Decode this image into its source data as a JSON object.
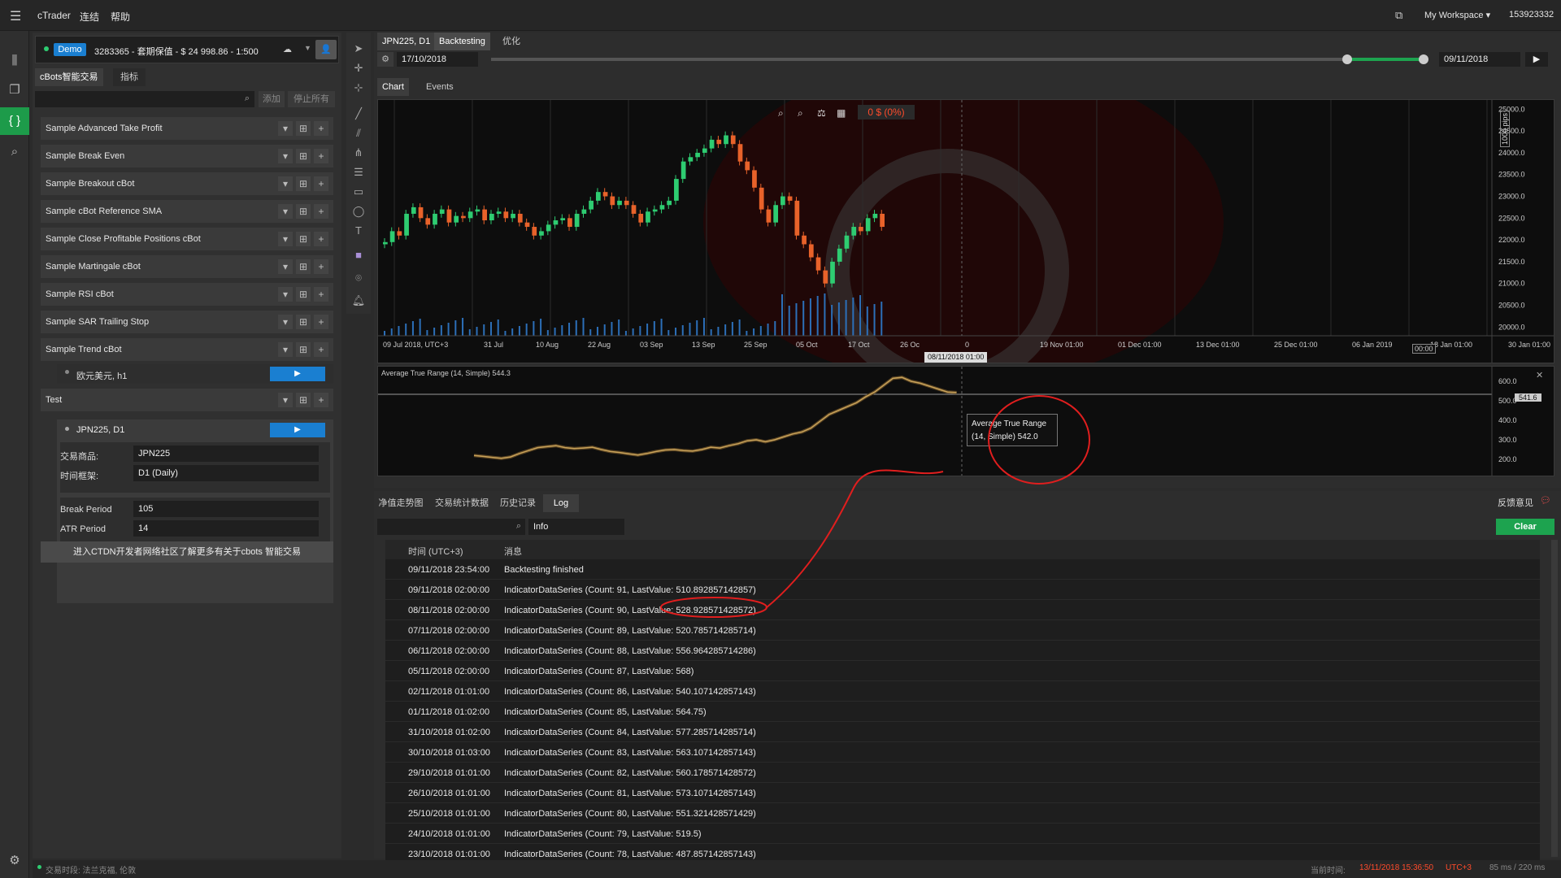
{
  "app": {
    "title": "cTrader",
    "menus": [
      "连结",
      "帮助"
    ],
    "workspace": "My Workspace ▾",
    "account_number": "153923332"
  },
  "account": {
    "badge": "Demo",
    "text": "3283365 - 套期保值 - $ 24 998.86 - 1:500"
  },
  "left_tabs": [
    "cBots智能交易",
    "指标"
  ],
  "search": {
    "placeholder": "",
    "add": "添加",
    "stop_all": "停止所有"
  },
  "bots": [
    "Sample Advanced Take Profit",
    "Sample Break Even",
    "Sample Breakout cBot",
    "Sample cBot Reference SMA",
    "Sample Close Profitable Positions cBot",
    "Sample Martingale cBot",
    "Sample RSI cBot",
    "Sample SAR Trailing Stop",
    "Sample Trend cBot"
  ],
  "trend_instance": "欧元美元, h1",
  "test_bot": {
    "name": "Test",
    "instance": "JPN225, D1",
    "params": [
      {
        "label": "交易商品:",
        "value": "JPN225"
      },
      {
        "label": "时间框架:",
        "value": "D1 (Daily)"
      },
      {
        "label": "Break Period",
        "value": "105"
      },
      {
        "label": "ATR Period",
        "value": "14"
      }
    ]
  },
  "community_link": "进入CTDN开发者网络社区了解更多有关于cbots 智能交易",
  "chart_tabs": [
    "JPN225, D1",
    "Backtesting",
    "优化"
  ],
  "backtest": {
    "from": "17/10/2018",
    "to": "09/11/2018"
  },
  "chart_subtabs": [
    "Chart",
    "Events"
  ],
  "chart_overlay": {
    "pnl": "0 $ (0%)",
    "pips_label": "1000 pips",
    "crosshair_date": "08/11/2018 01:00",
    "indicator_title": "Average True Range (14, Simple) 544.3",
    "indicator_value": "541.6",
    "tooltip_line1": "Average True Range",
    "tooltip_line2": "(14, Simple)  542.0",
    "time_marker": "00:00"
  },
  "chart_data": {
    "type": "candlestick",
    "y_ticks": [
      "25000.0",
      "24500.0",
      "24000.0",
      "23500.0",
      "23000.0",
      "22500.0",
      "22000.0",
      "21500.0",
      "21000.0",
      "20500.0",
      "20000.0"
    ],
    "x_ticks": [
      "09 Jul 2018, UTC+3",
      "31 Jul",
      "10 Aug",
      "22 Aug",
      "03 Sep",
      "13 Sep",
      "25 Sep",
      "05 Oct",
      "17 Oct",
      "26 Oc",
      "0",
      "19 Nov 01:00",
      "01 Dec 01:00",
      "13 Dec 01:00",
      "25 Dec 01:00",
      "06 Jan 2019",
      "18 Jan 01:00",
      "30 Jan 01:00"
    ],
    "close": [
      21950,
      22200,
      22100,
      22600,
      22750,
      22500,
      22350,
      22600,
      22700,
      22400,
      22550,
      22500,
      22650,
      22700,
      22450,
      22600,
      22650,
      22500,
      22600,
      22400,
      22300,
      22100,
      22200,
      22350,
      22450,
      22500,
      22300,
      22600,
      22700,
      22900,
      23100,
      23000,
      22800,
      22900,
      22800,
      22600,
      22400,
      22650,
      22700,
      22800,
      22900,
      23400,
      23800,
      23900,
      24000,
      24100,
      24300,
      24200,
      24400,
      24200,
      23800,
      23600,
      23200,
      22700,
      22400,
      22800,
      23000,
      22900,
      22100,
      21900,
      21600,
      21300,
      21000,
      21500,
      21800,
      22100,
      22300,
      22200,
      22500,
      22600,
      22300
    ],
    "atr_ticks": [
      "600.0",
      "500.0",
      "400.0",
      "300.0",
      "200.0"
    ],
    "atr": [
      220,
      215,
      210,
      205,
      212,
      230,
      245,
      260,
      265,
      270,
      260,
      255,
      258,
      262,
      250,
      240,
      235,
      228,
      222,
      230,
      240,
      248,
      250,
      245,
      242,
      250,
      262,
      258,
      270,
      280,
      295,
      300,
      290,
      300,
      315,
      330,
      340,
      360,
      395,
      430,
      450,
      470,
      490,
      520,
      545,
      580,
      615,
      620,
      600,
      590,
      575,
      560,
      545,
      542
    ]
  },
  "bottom_tabs": [
    "净值走势图",
    "交易统计数据",
    "历史记录",
    "Log"
  ],
  "feedback": "反馈意见",
  "log": {
    "filter": "Info",
    "clear": "Clear",
    "col_time": "时间 (UTC+3)",
    "col_msg": "消息",
    "rows": [
      {
        "t": "09/11/2018 23:54:00",
        "m": "Backtesting finished"
      },
      {
        "t": "09/11/2018 02:00:00",
        "m": "IndicatorDataSeries (Count: 91, LastValue: 510.892857142857)"
      },
      {
        "t": "08/11/2018 02:00:00",
        "m": "IndicatorDataSeries (Count: 90, LastValue: 528.928571428572)"
      },
      {
        "t": "07/11/2018 02:00:00",
        "m": "IndicatorDataSeries (Count: 89, LastValue: 520.785714285714)"
      },
      {
        "t": "06/11/2018 02:00:00",
        "m": "IndicatorDataSeries (Count: 88, LastValue: 556.964285714286)"
      },
      {
        "t": "05/11/2018 02:00:00",
        "m": "IndicatorDataSeries (Count: 87, LastValue: 568)"
      },
      {
        "t": "02/11/2018 01:01:00",
        "m": "IndicatorDataSeries (Count: 86, LastValue: 540.107142857143)"
      },
      {
        "t": "01/11/2018 01:02:00",
        "m": "IndicatorDataSeries (Count: 85, LastValue: 564.75)"
      },
      {
        "t": "31/10/2018 01:02:00",
        "m": "IndicatorDataSeries (Count: 84, LastValue: 577.285714285714)"
      },
      {
        "t": "30/10/2018 01:03:00",
        "m": "IndicatorDataSeries (Count: 83, LastValue: 563.107142857143)"
      },
      {
        "t": "29/10/2018 01:01:00",
        "m": "IndicatorDataSeries (Count: 82, LastValue: 560.178571428572)"
      },
      {
        "t": "26/10/2018 01:01:00",
        "m": "IndicatorDataSeries (Count: 81, LastValue: 573.107142857143)"
      },
      {
        "t": "25/10/2018 01:01:00",
        "m": "IndicatorDataSeries (Count: 80, LastValue: 551.321428571429)"
      },
      {
        "t": "24/10/2018 01:01:00",
        "m": "IndicatorDataSeries (Count: 79, LastValue: 519.5)"
      },
      {
        "t": "23/10/2018 01:01:00",
        "m": "IndicatorDataSeries (Count: 78, LastValue: 487.857142857143)"
      }
    ]
  },
  "status": {
    "session_label": "交易时段: 法兰克福, 伦敦",
    "current_time_label": "当前时间:",
    "current_time": "13/11/2018 15:36:50",
    "tz": "UTC+3",
    "latency": "85 ms / 220 ms"
  },
  "colors": {
    "bull": "#2ecc71",
    "bear": "#e8622a",
    "accent": "#1a7fd1",
    "atr_line": "#c8a25a",
    "annotation": "#e01e1e"
  }
}
